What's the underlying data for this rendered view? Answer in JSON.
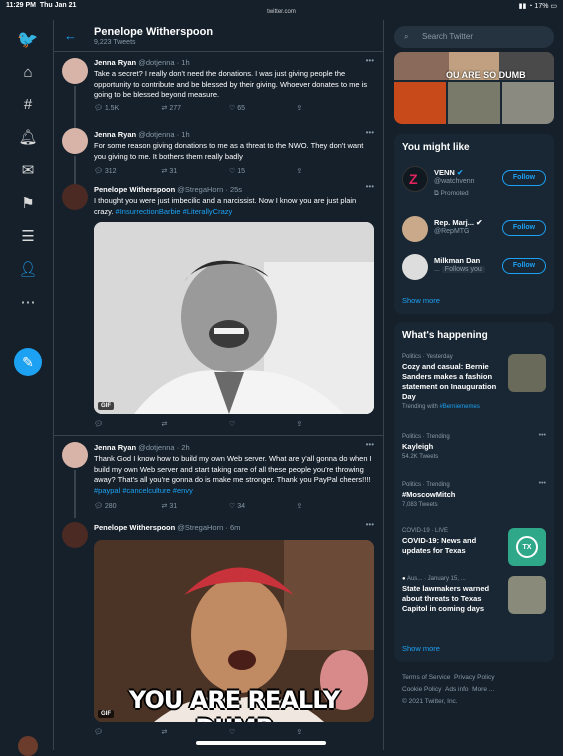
{
  "status": {
    "time": "11:29 PM",
    "date": "Thu Jan 21",
    "url": "twitter.com",
    "battery": "17%"
  },
  "nav": {
    "icons": [
      "twitter-logo-icon",
      "explore-icon",
      "hashtag-icon",
      "notifications-icon",
      "messages-icon",
      "bookmarks-icon",
      "lists-icon",
      "profile-icon",
      "more-icon",
      "compose-icon"
    ]
  },
  "feed": {
    "title": "Penelope Witherspoon",
    "tweet_count": "9,223 Tweets",
    "tweets": [
      {
        "name": "Jenna Ryan",
        "handle": "@dotjenna",
        "time": "· 1h",
        "text": "Take a secret? I really don't need the donations. I was just giving people the opportunity to contribute and be blessed by their giving. Whoever donates to me is going to be blessed beyond measure.",
        "replies": "1.5K",
        "retweets": "277",
        "likes": "65"
      },
      {
        "name": "Jenna Ryan",
        "handle": "@dotjenna",
        "time": "· 1h",
        "text": "For some reason giving donations to me as a threat to the NWO. They don't want you giving to me. It bothers them really badly",
        "replies": "312",
        "retweets": "31",
        "likes": "15"
      },
      {
        "name": "Penelope Witherspoon",
        "handle": "@StregaHorn",
        "time": "· 25s",
        "text": "I thought you were just imbecilic and a narcissist.  Now I know you are just plain crazy. ",
        "tags": "#InsurrectionBarbie #LiterallyCrazy",
        "gif": "GIF"
      },
      {
        "name": "Jenna Ryan",
        "handle": "@dotjenna",
        "time": "· 2h",
        "text": "Thank God I know how to build my own Web server. What are y'all gonna do when I build my own Web server and start taking care of all these people you're throwing away? That's all you're gonna do is make me stronger. Thank you PayPal cheers!!!! ",
        "tags": "#paypal #cancelculture #envy",
        "replies": "280",
        "retweets": "31",
        "likes": "34"
      },
      {
        "name": "Penelope Witherspoon",
        "handle": "@StregaHorn",
        "time": "· 6m",
        "caption": "YOU ARE REALLY DUMB",
        "gif": "GIF"
      }
    ]
  },
  "side": {
    "search_placeholder": "Search Twitter",
    "banner_text": "OU ARE SO DUMB",
    "follow_title": "You might like",
    "who": [
      {
        "name": "VENN",
        "handle": "@watchvenn",
        "extra": "Promoted",
        "btn": "Follow"
      },
      {
        "name": "Rep. Marj...",
        "handle": "@RepMTG",
        "btn": "Follow"
      },
      {
        "name": "Milkman Dan",
        "handle": "...",
        "extra": "Follows you",
        "btn": "Follow"
      }
    ],
    "show_more": "Show more",
    "happening_title": "What's happening",
    "trends": [
      {
        "cat": "Politics · Yesterday",
        "head": "Cozy and casual: Bernie Sanders makes a fashion statement on Inauguration Day",
        "sub": "Trending with ",
        "sub_tag": "#Berniememes"
      },
      {
        "cat": "Politics · Trending",
        "head": "Kayleigh",
        "sub": "54.2K Tweets"
      },
      {
        "cat": "Politics · Trending",
        "head": "#MoscowMitch",
        "sub": "7,083 Tweets"
      },
      {
        "cat": "COVID-19 · LIVE",
        "head": "COVID-19: News and updates for Texas",
        "badge": "TX"
      },
      {
        "cat": "Aus... · January 15, ...",
        "head": "State lawmakers warned about threats to Texas Capitol in coming days"
      }
    ],
    "footer": [
      "Terms of Service",
      "Privacy Policy",
      "Cookie Policy",
      "Ads info",
      "More ...",
      "© 2021 Twitter, Inc."
    ]
  }
}
